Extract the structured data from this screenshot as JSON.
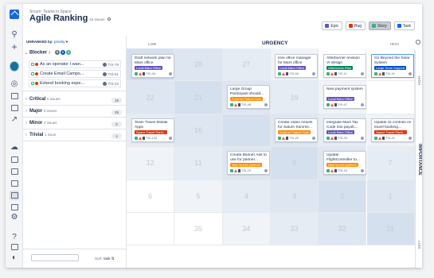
{
  "breadcrumb": "Scrum: Teams in Space",
  "title": "Agile Ranking",
  "issue_count": "16 issues",
  "filters": [
    {
      "label": "Epic",
      "color": "#6554c0",
      "active": false
    },
    {
      "label": "Bug",
      "color": "#de350b",
      "active": false
    },
    {
      "label": "Story",
      "color": "#36b37e",
      "active": true
    },
    {
      "label": "Task",
      "color": "#0065ff",
      "active": false
    }
  ],
  "list": {
    "heading": "UNRANKED by:",
    "sort_field": "priority",
    "groups": {
      "blocker": {
        "label": "Blocker",
        "count": "3",
        "c1": "5",
        "c2": "0",
        "c3": "3"
      },
      "critical": {
        "label": "Critical",
        "count": "0 issues",
        "badge": "15"
      },
      "major": {
        "label": "Major",
        "count": "0 issues",
        "badge": "25"
      },
      "minor": {
        "label": "Minor",
        "count": "4 issues",
        "badge": "0"
      },
      "trivial": {
        "label": "Trivial",
        "count": "1 issue",
        "badge": "4"
      }
    },
    "issues": [
      {
        "title": "As an operator I wan...",
        "key": "TIS-79"
      },
      {
        "title": "Create Email Camps...",
        "key": "TIS-51"
      },
      {
        "title": "Extend booking expe...",
        "key": "TIS-43"
      }
    ],
    "sort_label": "Sort:",
    "sort_value": "rank"
  },
  "axes": {
    "low": "LOW",
    "urgency": "URGENCY",
    "high": "HIGH",
    "importance": "IMPORTANCE",
    "r_high": "HIGH",
    "r_low": "LOW"
  },
  "cells": [
    "",
    "28",
    "27",
    "26",
    "",
    "",
    "22",
    "21",
    "",
    "19",
    "",
    "",
    "",
    "16",
    "",
    "",
    "14",
    "",
    "12",
    "11",
    "",
    "9",
    "",
    "7",
    "6",
    "5",
    "4",
    "3",
    "2",
    "1",
    "",
    "35",
    "34",
    "33",
    "32",
    "31"
  ],
  "cards": {
    "c1": {
      "title": "Draft network plan for Mars office",
      "label": "Local Mars Office",
      "color": "#6554c0",
      "key": "TIS-48"
    },
    "c2": {
      "title": "Hire office manager for Mars office",
      "label": "Local Mars Office",
      "color": "#6554c0",
      "key": "TIS-56"
    },
    "c3": {
      "title": "Afterburner revision VI design",
      "label": "Afterburner Rise",
      "color": "#00875a",
      "key": "TIS-11"
    },
    "c4": {
      "title": "Go Beyond the Solar System",
      "label": "Large Team Support",
      "color": "#0052cc",
      "key": "TIS-31"
    },
    "c5": {
      "title": "Large Group Participant should...",
      "label": "Summer Saturn Sale",
      "color": "#ff8b00",
      "key": "TIS-48"
    },
    "c6": {
      "title": "New payment system",
      "label": "Local Mars Office",
      "color": "#6554c0",
      "key": "TIS-67"
    },
    "c7": {
      "title": "Team Travel Mobile Apps",
      "label": "Space Travel Partn...",
      "color": "#de350b",
      "key": "TIS-132"
    },
    "c8": {
      "title": "Create Video Assets for Saturn Summe...",
      "label": "Summer Saturn Sale",
      "color": "#ff8b00",
      "key": "TIS-20"
    },
    "c9": {
      "title": "Integrate Mars Tax Code into payolt...",
      "label": "Local Mars Office",
      "color": "#6554c0",
      "key": "TIS-25"
    },
    "c10": {
      "title": "Update UI controls on travel booking...",
      "label": "Space Travel Partn...",
      "color": "#de350b",
      "key": "TIS-41"
    },
    "c11": {
      "title": "Create Banner Ads to use for partner...",
      "label": "New launch platform",
      "color": "#ff8b00",
      "key": "TIS-19"
    },
    "c12": {
      "title": "Update FlightController to...",
      "label": "New launch platform",
      "color": "#ff8b00",
      "key": "TIS-16"
    }
  }
}
